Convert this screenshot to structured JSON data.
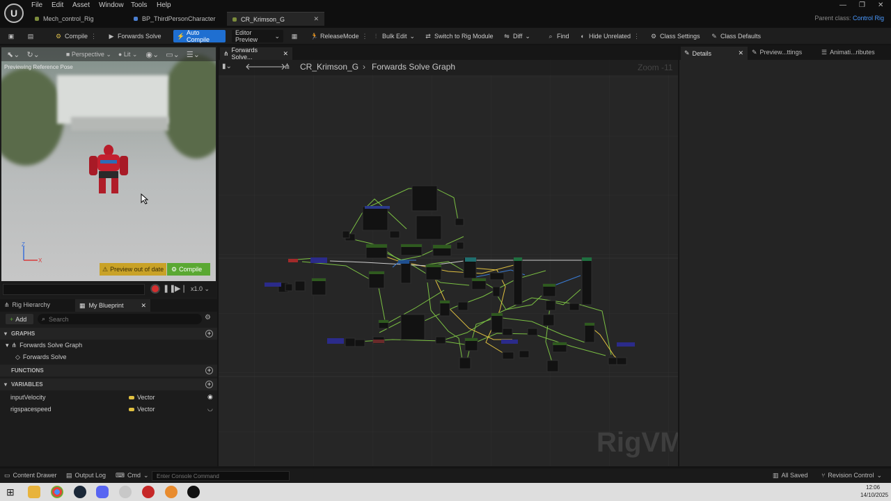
{
  "menubar": {
    "items": [
      "File",
      "Edit",
      "Asset",
      "Window",
      "Tools",
      "Help"
    ],
    "tabs": [
      "Mech_control_Rig",
      "BP_ThirdPersonCharacter",
      "CR_Krimson_G"
    ],
    "parent_label": "Parent class:",
    "parent_value": "Control Rig"
  },
  "toolbar": {
    "compile": "Compile",
    "forwards_solve": "Forwards Solve",
    "auto_compile": "Auto Compile",
    "editor_preview": "Editor Preview",
    "release_mode": "ReleaseMode",
    "bulk_edit": "Bulk Edit",
    "switch_rig_module": "Switch to Rig Module",
    "diff": "Diff",
    "find": "Find",
    "hide_unrelated": "Hide Unrelated",
    "class_settings": "Class Settings",
    "class_defaults": "Class Defaults"
  },
  "viewport": {
    "perspective": "Perspective",
    "lit": "Lit",
    "previewing": "Previewing Reference Pose",
    "preview_out_of_date": "Preview out of date",
    "compile_btn": "Compile",
    "speed": "x1.0",
    "axis_z": "Z",
    "axis_x": "X"
  },
  "hierarchy": {
    "tab_rig": "Rig Hierarchy",
    "tab_blueprint": "My Blueprint",
    "add": "Add",
    "search_placeholder": "Search",
    "graphs_header": "GRAPHS",
    "graph_item": "Forwards Solve Graph",
    "graph_subitem": "Forwards Solve",
    "functions_header": "FUNCTIONS",
    "variables_header": "VARIABLES",
    "variables": [
      {
        "name": "inputVelocity",
        "type": "Vector"
      },
      {
        "name": "rigspacespeed",
        "type": "Vector"
      }
    ]
  },
  "graph": {
    "tab": "Forwards Solve...",
    "crumb_root": "CR_Krimson_G",
    "crumb_leaf": "Forwards Solve Graph",
    "zoom": "Zoom -11",
    "watermark": "RigVM"
  },
  "details": {
    "tabs": [
      "Details",
      "Preview...ttings",
      "Animati...ributes"
    ]
  },
  "statusbar": {
    "content_drawer": "Content Drawer",
    "output_log": "Output Log",
    "cmd": "Cmd",
    "console_placeholder": "Enter Console Command",
    "all_saved": "All Saved",
    "revision_control": "Revision Control"
  },
  "taskbar": {
    "time": "12:06",
    "date": "14/10/2025"
  },
  "colors": {
    "accent_blue": "#1f6fd1",
    "vector_pin": "#e0c040",
    "warning_yellow": "#c9a227",
    "compile_green": "#5aa832"
  }
}
